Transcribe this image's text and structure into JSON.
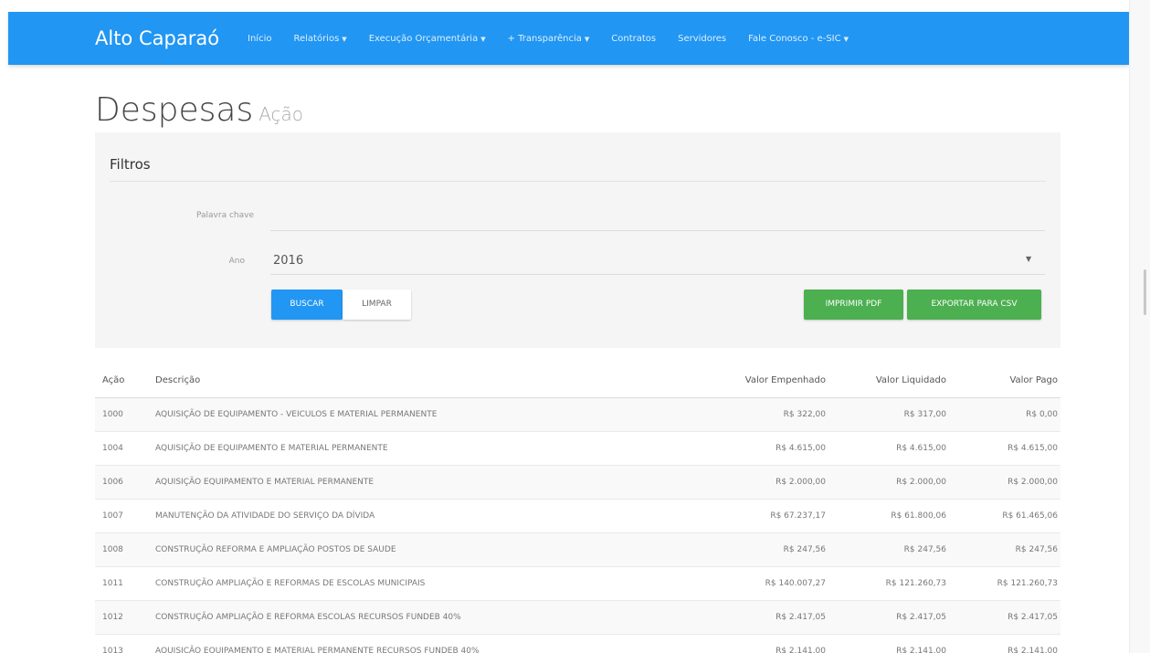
{
  "navbar": {
    "brand": "Alto Caparaó",
    "items": [
      {
        "label": "Início",
        "dropdown": false
      },
      {
        "label": "Relatórios",
        "dropdown": true
      },
      {
        "label": "Execução Orçamentária",
        "dropdown": true
      },
      {
        "label": "+ Transparência",
        "dropdown": true
      },
      {
        "label": "Contratos",
        "dropdown": false
      },
      {
        "label": "Servidores",
        "dropdown": false
      },
      {
        "label": "Fale Conosco - e-SIC",
        "dropdown": true
      }
    ],
    "color": "#2196f3"
  },
  "page": {
    "title": "Despesas",
    "subtitle": "Ação"
  },
  "filters": {
    "title": "Filtros",
    "keyword_label": "Palavra chave",
    "keyword_value": "",
    "year_label": "Ano",
    "year_value": "2016",
    "search_button": "BUSCAR",
    "clear_button": "LIMPAR",
    "pdf_button": "IMPRIMIR PDF",
    "csv_button": "EXPORTAR PARA CSV"
  },
  "table": {
    "headers": {
      "acao": "Ação",
      "descricao": "Descrição",
      "empenhado": "Valor Empenhado",
      "liquidado": "Valor Liquidado",
      "pago": "Valor Pago"
    },
    "rows": [
      {
        "acao": "1000",
        "descricao": "AQUISIÇÃO DE EQUIPAMENTO - VEICULOS E MATERIAL PERMANENTE",
        "empenhado": "R$ 322,00",
        "liquidado": "R$ 317,00",
        "pago": "R$ 0,00"
      },
      {
        "acao": "1004",
        "descricao": "AQUISIÇÃO DE EQUIPAMENTO E MATERIAL PERMANENTE",
        "empenhado": "R$ 4.615,00",
        "liquidado": "R$ 4.615,00",
        "pago": "R$ 4.615,00"
      },
      {
        "acao": "1006",
        "descricao": "AQUISIÇÃO EQUIPAMENTO E MATERIAL PERMANENTE",
        "empenhado": "R$ 2.000,00",
        "liquidado": "R$ 2.000,00",
        "pago": "R$ 2.000,00"
      },
      {
        "acao": "1007",
        "descricao": "MANUTENÇÃO DA ATIVIDADE DO SERVIÇO DA DÍVIDA",
        "empenhado": "R$ 67.237,17",
        "liquidado": "R$ 61.800,06",
        "pago": "R$ 61.465,06"
      },
      {
        "acao": "1008",
        "descricao": "CONSTRUÇÃO REFORMA E AMPLIAÇÃO POSTOS DE SAUDE",
        "empenhado": "R$ 247,56",
        "liquidado": "R$ 247,56",
        "pago": "R$ 247,56"
      },
      {
        "acao": "1011",
        "descricao": "CONSTRUÇÃO AMPLIAÇÃO E REFORMAS DE ESCOLAS MUNICIPAIS",
        "empenhado": "R$ 140.007,27",
        "liquidado": "R$ 121.260,73",
        "pago": "R$ 121.260,73"
      },
      {
        "acao": "1012",
        "descricao": "CONSTRUÇÃO AMPLIAÇÃO E REFORMA ESCOLAS RECURSOS FUNDEB 40%",
        "empenhado": "R$ 2.417,05",
        "liquidado": "R$ 2.417,05",
        "pago": "R$ 2.417,05"
      },
      {
        "acao": "1013",
        "descricao": "AQUISIÇÃO EQUIPAMENTO E MATERIAL PERMANENTE RECURSOS FUNDEB 40%",
        "empenhado": "R$ 2.141,00",
        "liquidado": "R$ 2.141,00",
        "pago": "R$ 2.141,00"
      }
    ]
  }
}
